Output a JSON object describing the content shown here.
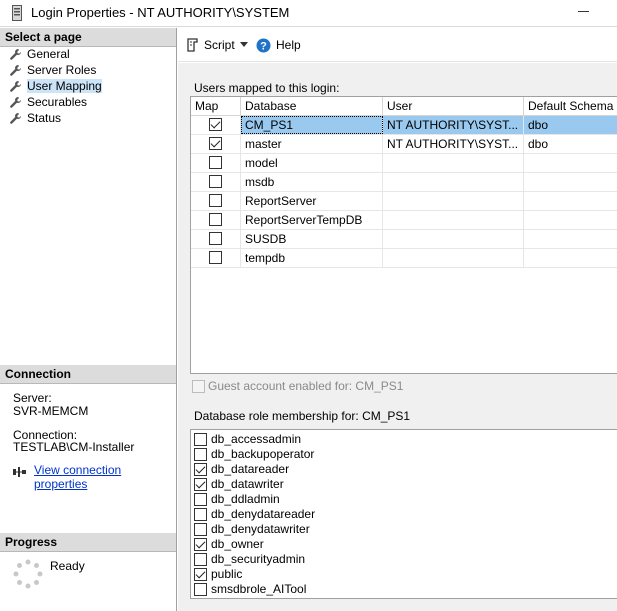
{
  "window": {
    "title": "Login Properties - NT AUTHORITY\\SYSTEM"
  },
  "left": {
    "select_page_title": "Select a page",
    "pages": [
      {
        "label": "General",
        "icon": "wrench-icon"
      },
      {
        "label": "Server Roles",
        "icon": "wrench-icon"
      },
      {
        "label": "User Mapping",
        "icon": "wrench-icon",
        "selected": true
      },
      {
        "label": "Securables",
        "icon": "wrench-icon"
      },
      {
        "label": "Status",
        "icon": "wrench-icon"
      }
    ],
    "connection_title": "Connection",
    "server_label": "Server:",
    "server_value": "SVR-MEMCM",
    "connection_label": "Connection:",
    "connection_value": "TESTLAB\\CM-Installer",
    "view_props_link": "View connection properties",
    "progress_title": "Progress",
    "progress_status": "Ready"
  },
  "toolbar": {
    "script_label": "Script",
    "help_label": "Help"
  },
  "mapping": {
    "users_mapped_label": "Users mapped to this login:",
    "columns": [
      "Map",
      "Database",
      "User",
      "Default Schema"
    ],
    "rows": [
      {
        "mapped": true,
        "database": "CM_PS1",
        "user": "NT AUTHORITY\\SYST...",
        "schema": "dbo",
        "selected": true
      },
      {
        "mapped": true,
        "database": "master",
        "user": "NT AUTHORITY\\SYST...",
        "schema": "dbo"
      },
      {
        "mapped": false,
        "database": "model",
        "user": "",
        "schema": ""
      },
      {
        "mapped": false,
        "database": "msdb",
        "user": "",
        "schema": ""
      },
      {
        "mapped": false,
        "database": "ReportServer",
        "user": "",
        "schema": ""
      },
      {
        "mapped": false,
        "database": "ReportServerTempDB",
        "user": "",
        "schema": ""
      },
      {
        "mapped": false,
        "database": "SUSDB",
        "user": "",
        "schema": ""
      },
      {
        "mapped": false,
        "database": "tempdb",
        "user": "",
        "schema": ""
      }
    ],
    "guest_label": "Guest account enabled for: CM_PS1",
    "roles_label": "Database role membership for: CM_PS1",
    "roles": [
      {
        "name": "db_accessadmin",
        "checked": false
      },
      {
        "name": "db_backupoperator",
        "checked": false
      },
      {
        "name": "db_datareader",
        "checked": true
      },
      {
        "name": "db_datawriter",
        "checked": true
      },
      {
        "name": "db_ddladmin",
        "checked": false
      },
      {
        "name": "db_denydatareader",
        "checked": false
      },
      {
        "name": "db_denydatawriter",
        "checked": false
      },
      {
        "name": "db_owner",
        "checked": true
      },
      {
        "name": "db_securityadmin",
        "checked": false
      },
      {
        "name": "public",
        "checked": true
      },
      {
        "name": "smsdbrole_AITool",
        "checked": false
      }
    ]
  }
}
